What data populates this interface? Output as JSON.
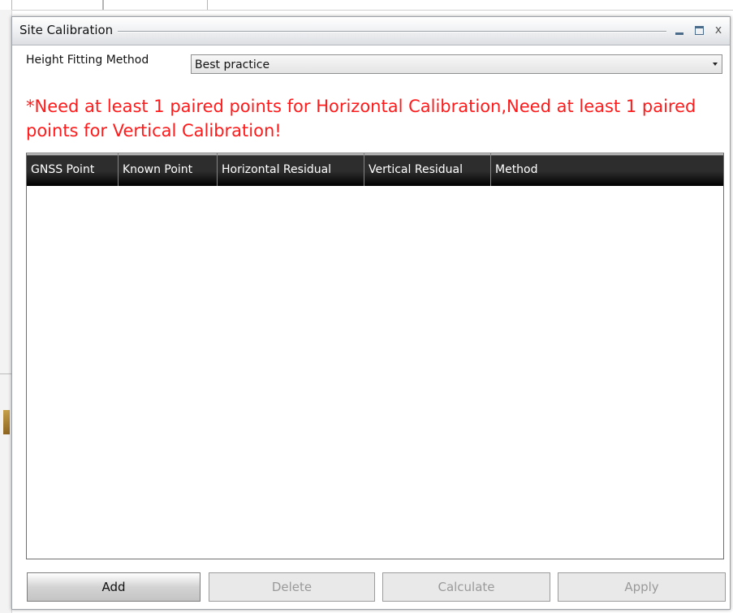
{
  "window": {
    "title": "Site Calibration",
    "controls": {
      "minimize_icon": "minimize-icon",
      "maximize_icon": "maximize-icon",
      "close_glyph": "x"
    }
  },
  "height_fitting": {
    "label": "Height Fitting Method",
    "selected": "Best practice"
  },
  "warning": "*Need at least 1 paired points for Horizontal Calibration,Need at least 1 paired points for Vertical Calibration!",
  "table": {
    "columns": [
      "GNSS Point",
      "Known Point",
      "Horizontal Residual",
      "Vertical Residual",
      "Method"
    ],
    "rows": []
  },
  "buttons": {
    "add": "Add",
    "delete": "Delete",
    "calculate": "Calculate",
    "apply": "Apply"
  },
  "colors": {
    "warning": "#ff1b1b",
    "header_bg": "#2d2d2d",
    "disabled_text": "#9a9a9a"
  }
}
